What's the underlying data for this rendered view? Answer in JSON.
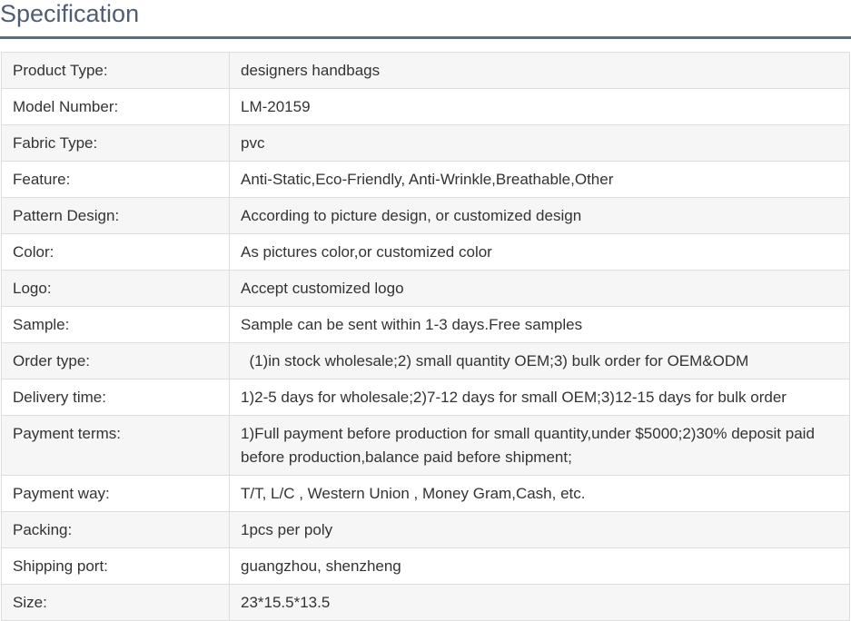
{
  "title": "Specification",
  "rows": [
    {
      "label": "Product Type:",
      "value": "designers handbags"
    },
    {
      "label": "Model Number:",
      "value": "LM-20159"
    },
    {
      "label": "Fabric Type:",
      "value": "pvc"
    },
    {
      "label": "Feature:",
      "value": "Anti-Static,Eco-Friendly, Anti-Wrinkle,Breathable,Other"
    },
    {
      "label": "Pattern Design:",
      "value": "According to picture design, or customized design"
    },
    {
      "label": "Color:",
      "value": "As pictures color,or customized color"
    },
    {
      "label": "Logo:",
      "value": "Accept customized logo"
    },
    {
      "label": "Sample:",
      "value": "Sample can be sent within 1-3 days.Free samples"
    },
    {
      "label": "Order type:",
      "value": "  (1)in stock wholesale;2) small quantity OEM;3) bulk order for OEM&ODM"
    },
    {
      "label": "Delivery time:",
      "value": "1)2-5 days for wholesale;2)7-12 days for small OEM;3)12-15 days for bulk order"
    },
    {
      "label": "Payment terms:",
      "value": "1)Full payment before production for small quantity,under $5000;2)30% deposit paid before production,balance paid before shipment;"
    },
    {
      "label": "Payment way:",
      "value": "T/T, L/C , Western Union , Money Gram,Cash, etc."
    },
    {
      "label": "Packing:",
      "value": "1pcs per poly"
    },
    {
      "label": "Shipping port:",
      "value": "guangzhou, shenzheng"
    },
    {
      "label": "Size:",
      "value": "23*15.5*13.5"
    }
  ]
}
